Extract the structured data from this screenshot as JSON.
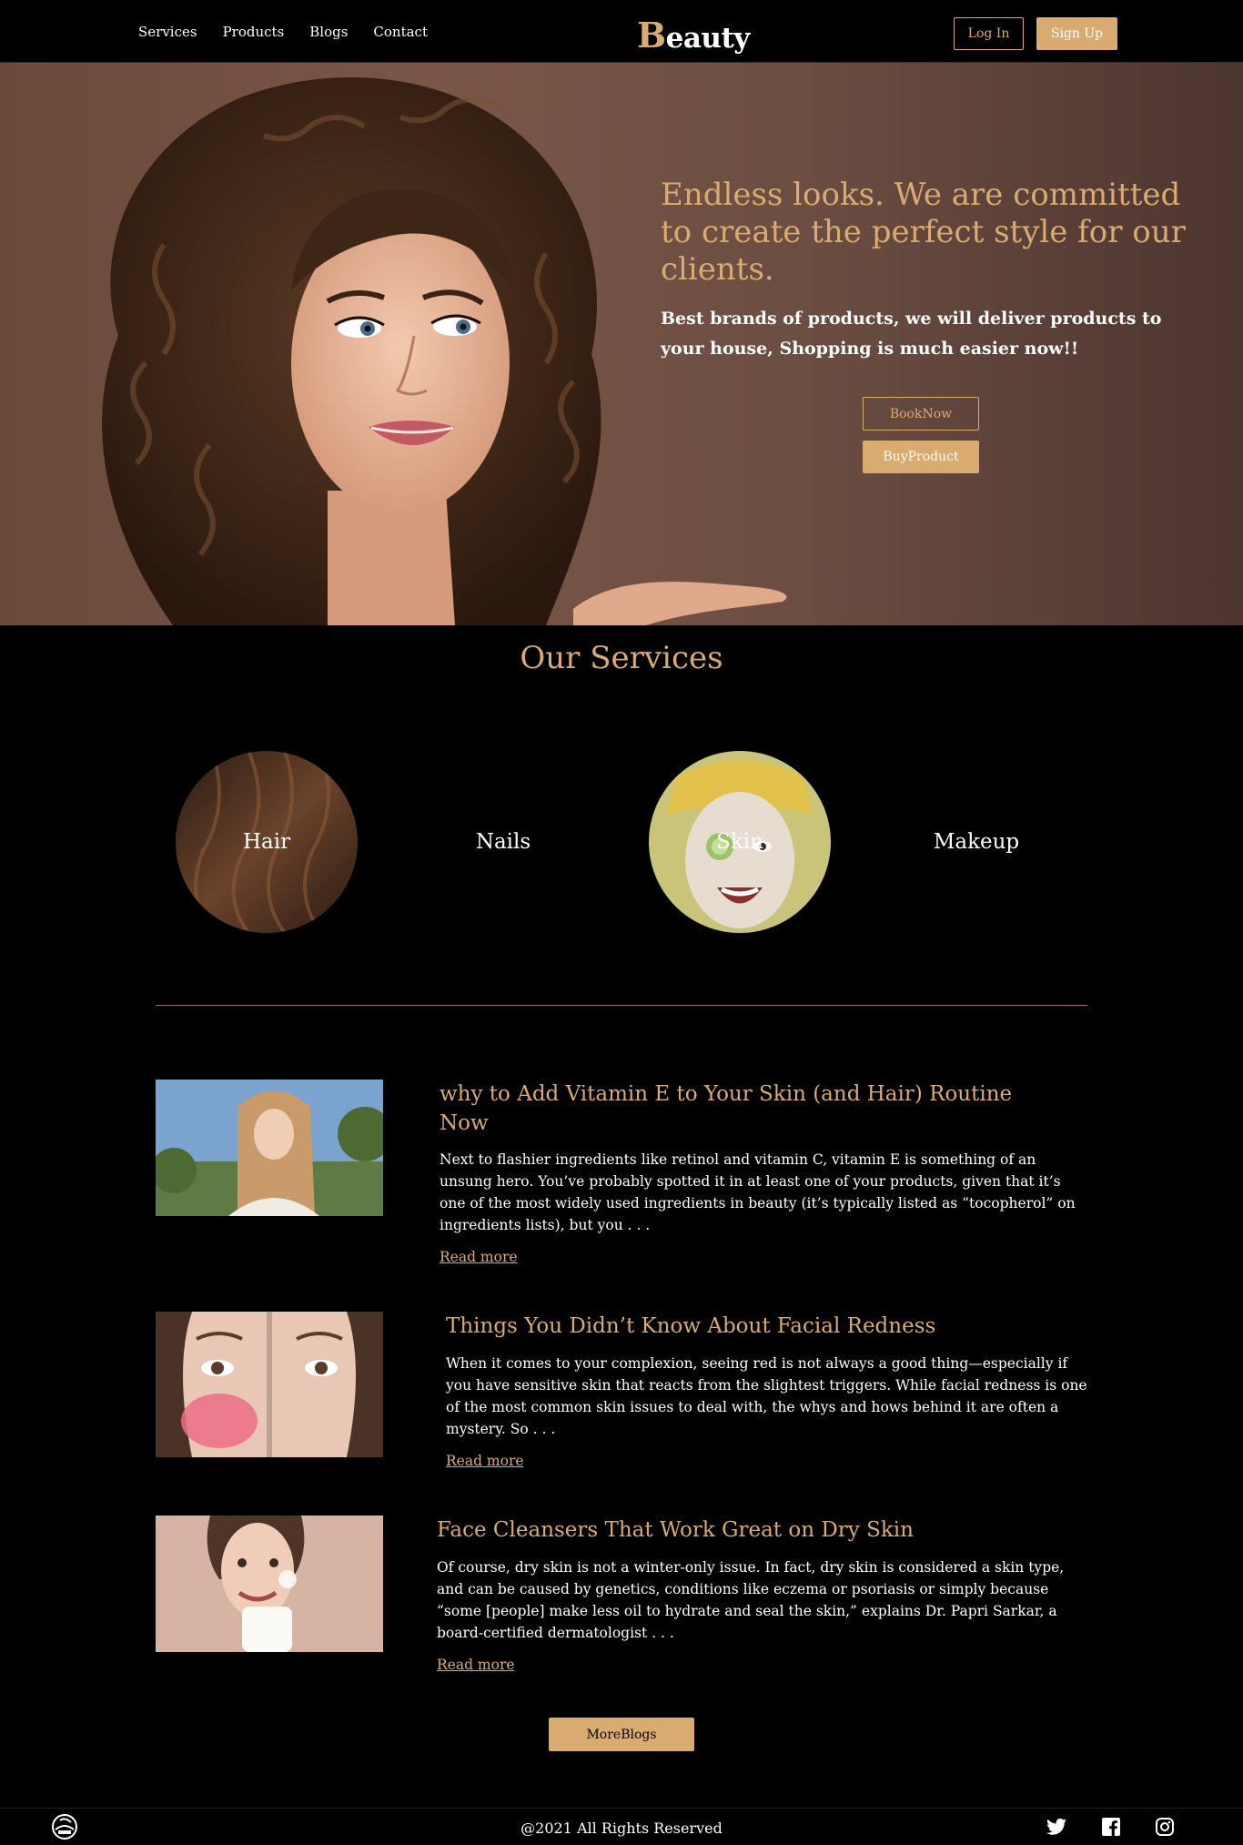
{
  "nav": {
    "links": [
      "Services",
      "Products",
      "Blogs",
      "Contact"
    ],
    "brand_first": "B",
    "brand_rest": "eauty",
    "login": "Log In",
    "signup": "Sign Up"
  },
  "hero": {
    "title": "Endless looks. We are committed to create the perfect style for our clients.",
    "subtitle": "Best brands of products, we will deliver products to your house, Shopping is much easier now!!",
    "book_button": "BookNow",
    "buy_button": "BuyProduct"
  },
  "services": {
    "title": "Our Services",
    "items": [
      "Hair",
      "Nails",
      "Skin",
      "Makeup"
    ]
  },
  "blogs": [
    {
      "title": "why to Add Vitamin E to Your Skin (and Hair) Routine Now",
      "text": "Next to flashier ingredients like retinol and vitamin C, vitamin E is something of an unsung hero. You’ve probably spotted it in at least one of your products, given that it’s one of the most widely used ingredients in beauty (it’s typically listed as “tocopherol” on ingredients lists), but you . . .",
      "link": "Read more"
    },
    {
      "title": "Things You Didn’t Know About Facial Redness",
      "text": "When it comes to your complexion, seeing red is not always a good thing—especially if you have sensitive skin that reacts from the slightest triggers. While facial redness is one of the most common skin issues to deal with, the whys and hows behind it are often a mystery. So . . .",
      "link": "Read more"
    },
    {
      "title": "Face Cleansers That Work Great on Dry Skin",
      "text": "Of course, dry skin is not a winter-only issue. In fact, dry skin is considered a skin type, and can be caused by genetics, conditions like eczema or psoriasis or simply because “some [people] make less oil to hydrate and seal the skin,” explains Dr. Papri Sarkar, a board-certified dermatologist . . .",
      "link": "Read more"
    }
  ],
  "more_blogs": "MoreBlogs",
  "footer": {
    "copyright": "@2021 All Rights Reserved",
    "icons": [
      "twitter-icon",
      "facebook-icon",
      "instagram-icon"
    ]
  },
  "colors": {
    "accent": "#d9ab70",
    "background": "#000000",
    "text": "#ffffff"
  }
}
